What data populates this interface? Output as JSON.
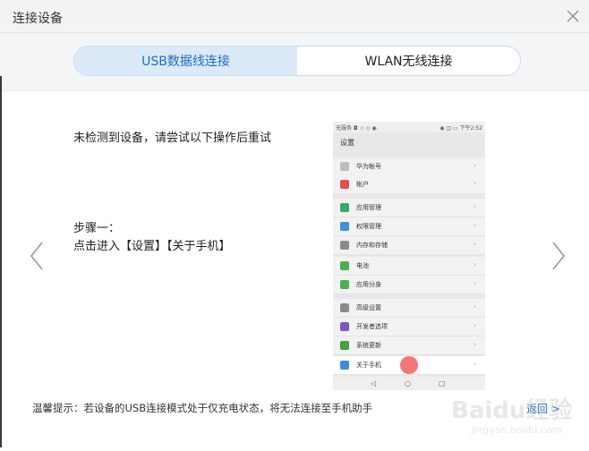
{
  "dialog": {
    "title": "连接设备",
    "close_icon": "close-icon"
  },
  "tabs": [
    {
      "label": "USB数据线连接",
      "active": true
    },
    {
      "label": "WLAN无线连接",
      "active": false
    }
  ],
  "content": {
    "message": "未检测到设备，请尝试以下操作后重试",
    "step_title": "步骤一：",
    "step_text": "点击进入【设置】【关于手机】"
  },
  "phone": {
    "status_left": "无服务 ◘ ☆ ◇ ◉",
    "status_right": "◉ ◫ ▭ 下午2:52",
    "settings_title": "设置",
    "items": [
      {
        "label": "华为帐号",
        "color": "#bdbdbd"
      },
      {
        "label": "帐户",
        "color": "#e05050"
      },
      {
        "label": "应用管理",
        "color": "#3aa66a"
      },
      {
        "label": "权限管理",
        "color": "#3f8fd8"
      },
      {
        "label": "内存和存储",
        "color": "#8a8a8a"
      },
      {
        "label": "电池",
        "color": "#4caf50"
      },
      {
        "label": "应用分身",
        "color": "#4caf50"
      },
      {
        "label": "高级设置",
        "color": "#8a8a8a"
      },
      {
        "label": "开发者选项",
        "color": "#7e57c2"
      },
      {
        "label": "系统更新",
        "color": "#43a047"
      },
      {
        "label": "关于手机",
        "color": "#3f8fd8"
      }
    ],
    "chevron": "›",
    "nav": {
      "back": "◁",
      "home": "○",
      "recent": "□"
    }
  },
  "footer": {
    "tip": "温馨提示：若设备的USB连接模式处于仅充电状态，将无法连接至手机助手",
    "back_label": "返回 >"
  },
  "watermark": {
    "brand": "Baidu经验",
    "url": "jingyan.baidu.com"
  }
}
